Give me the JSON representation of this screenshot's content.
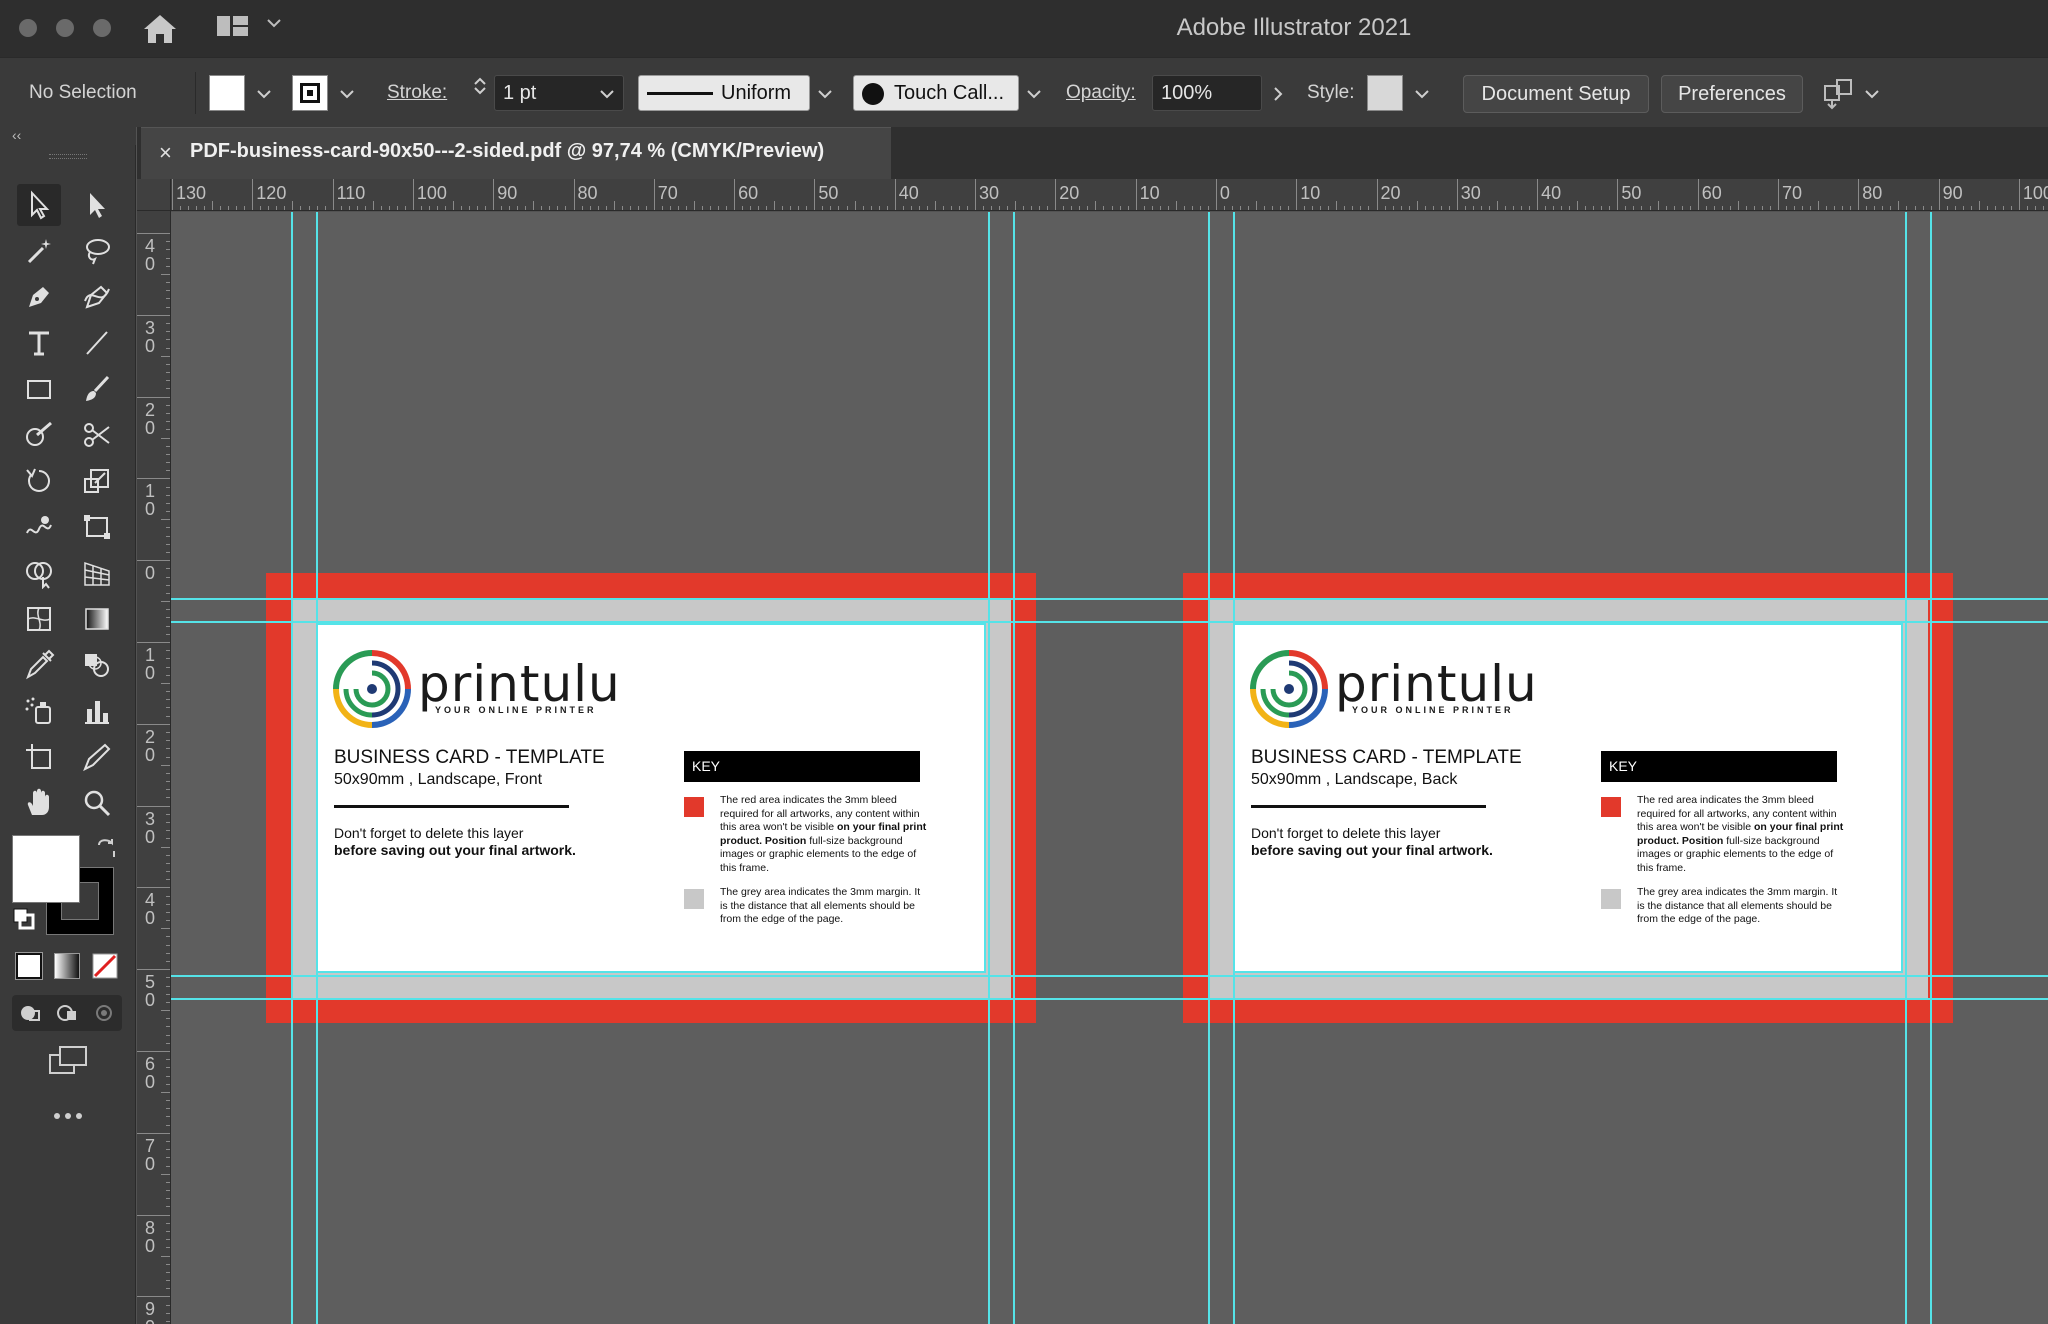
{
  "app": {
    "title": "Adobe Illustrator 2021"
  },
  "control_bar": {
    "selection": "No Selection",
    "stroke_label": "Stroke:",
    "stroke_weight": "1 pt",
    "profile": "Uniform",
    "brush": "Touch Call...",
    "opacity_label": "Opacity:",
    "opacity": "100%",
    "style_label": "Style:",
    "document_setup": "Document Setup",
    "preferences": "Preferences"
  },
  "panel": {
    "collapse": "‹‹"
  },
  "document": {
    "tab_close": "×",
    "tab_title": "PDF-business-card-90x50---2-sided.pdf @ 97,74 % (CMYK/Preview)"
  },
  "rulers": {
    "horizontal": [
      "130",
      "120",
      "110",
      "100",
      "90",
      "80",
      "70",
      "60",
      "50",
      "40",
      "30",
      "20",
      "10",
      "0",
      "10",
      "20",
      "30",
      "40",
      "50",
      "60",
      "70",
      "80",
      "90",
      "100"
    ],
    "vertical": [
      "40",
      "30",
      "20",
      "10",
      "0",
      "10",
      "20",
      "30",
      "40",
      "50",
      "60",
      "70",
      "80",
      "90"
    ]
  },
  "cards": [
    {
      "brand": "printulu",
      "tagline": "YOUR ONLINE PRINTER",
      "title": "BUSINESS CARD - TEMPLATE",
      "subtitle": "50x90mm , Landscape, Front",
      "note_line1": "Don't forget to delete this layer",
      "note_line2": "before saving out your final artwork.",
      "key_label": "KEY",
      "red_text_1": "The red area indicates the 3mm bleed required for all artworks, any content within this area won't be visible",
      "red_text_bold": "on your final print product. Position",
      "red_text_2": "full-size background images or graphic elements to the edge of this frame.",
      "grey_text": "The grey area indicates the 3mm margin. It is the distance that all elements should be from the edge of the page."
    },
    {
      "brand": "printulu",
      "tagline": "YOUR ONLINE PRINTER",
      "title": "BUSINESS CARD - TEMPLATE",
      "subtitle": "50x90mm , Landscape, Back",
      "note_line1": "Don't forget to delete this layer",
      "note_line2": "before saving out your final artwork.",
      "key_label": "KEY",
      "red_text_1": "The red area indicates the 3mm bleed required for all artworks, any content within this area won't be visible",
      "red_text_bold": "on your final print product. Position",
      "red_text_2": "full-size background images or graphic elements to the edge of this frame.",
      "grey_text": "The grey area indicates the 3mm margin. It is the distance that all elements should be from the edge of the page."
    }
  ],
  "colors": {
    "bleed": "#e2392b",
    "margin": "#c8c8c8",
    "guide": "#55e3e8",
    "canvas": "#5e5e5e"
  },
  "tools": [
    "selection-tool",
    "direct-selection-tool",
    "magic-wand-tool",
    "lasso-tool",
    "pen-tool",
    "curvature-tool",
    "type-tool",
    "line-segment-tool",
    "rectangle-tool",
    "paintbrush-tool",
    "shaper-tool",
    "scissors-tool",
    "rotate-tool",
    "scale-tool",
    "warp-tool",
    "free-transform-tool",
    "shape-builder-tool",
    "perspective-grid-tool",
    "mesh-tool",
    "gradient-tool",
    "eyedropper-tool",
    "blend-tool",
    "symbol-sprayer-tool",
    "graph-tool",
    "artboard-tool",
    "slice-tool",
    "hand-tool",
    "zoom-tool"
  ]
}
